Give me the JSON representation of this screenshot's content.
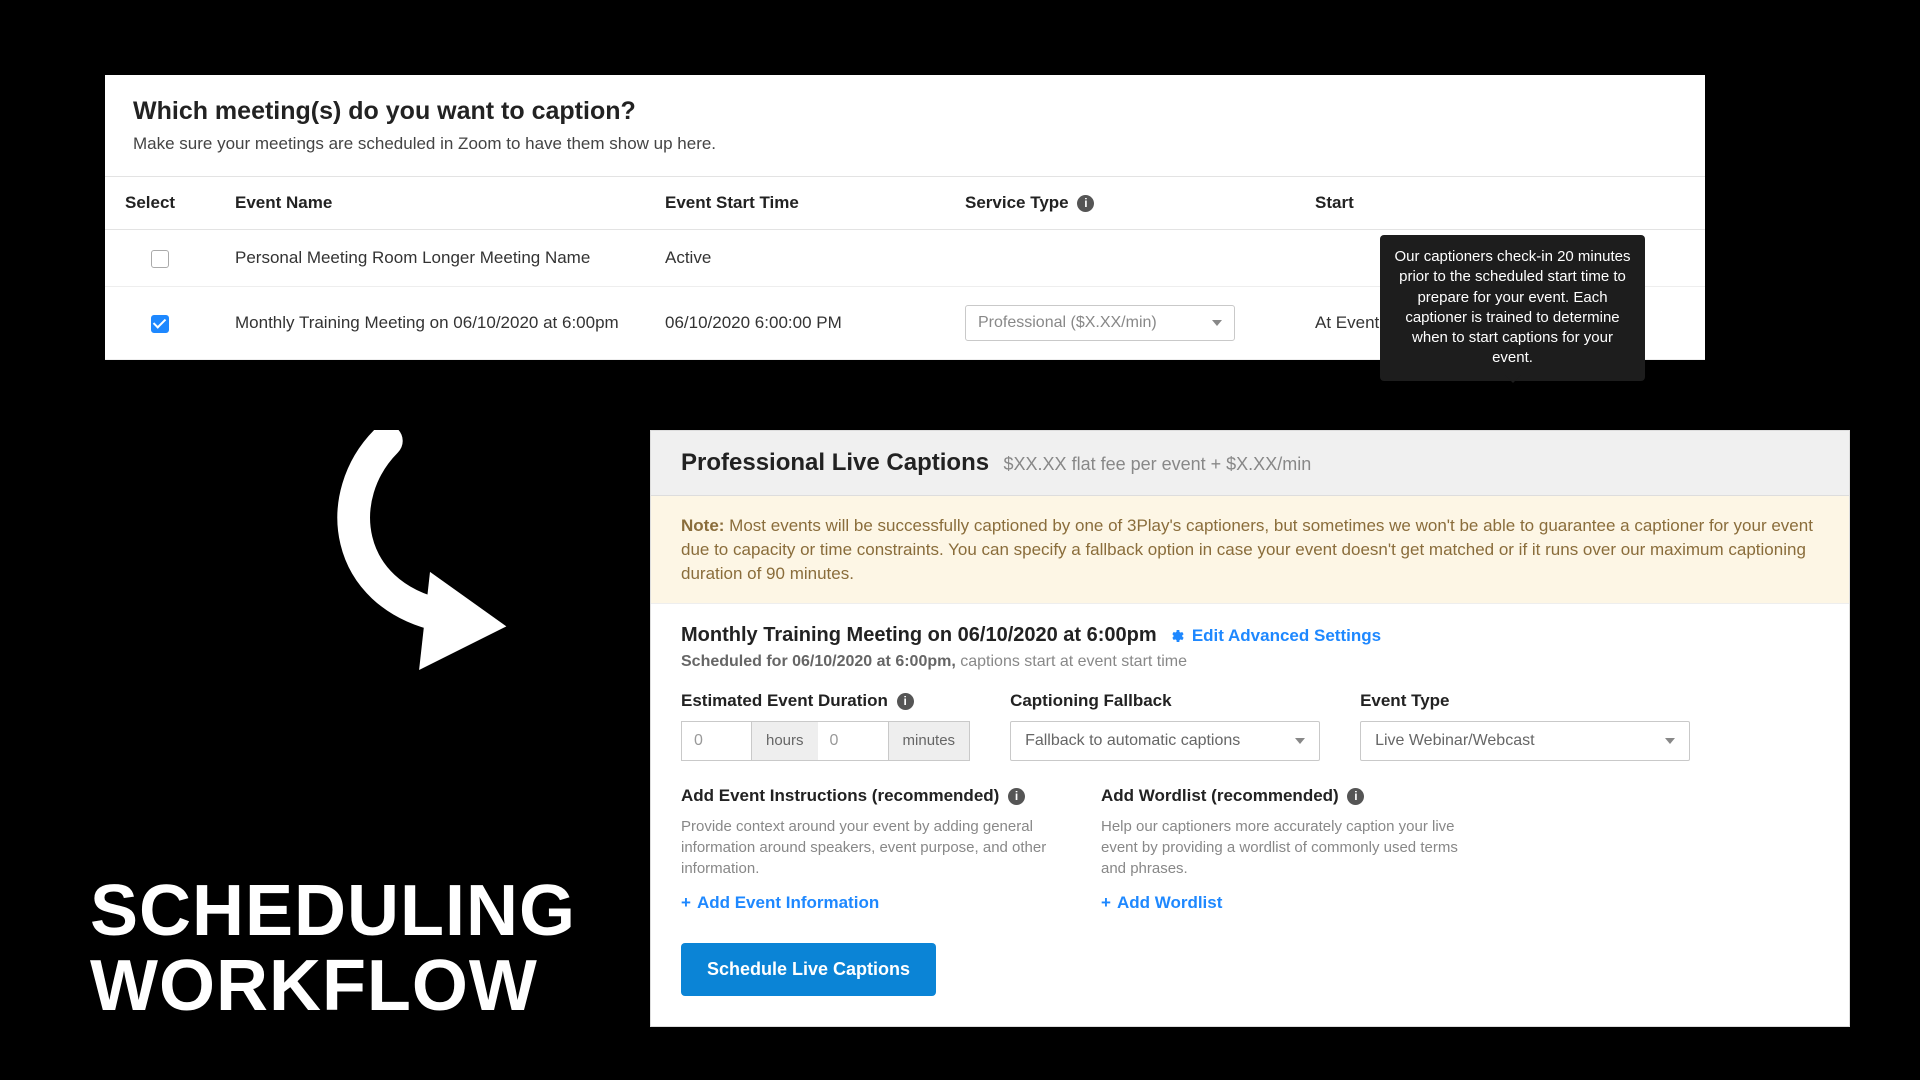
{
  "slide_caption_line1": "SCHEDULING",
  "slide_caption_line2": "WORKFLOW",
  "top": {
    "heading": "Which meeting(s) do you want to caption?",
    "subheading": "Make sure your meetings are scheduled in Zoom to have them show up here.",
    "columns": {
      "select": "Select",
      "event_name": "Event Name",
      "event_start_time": "Event Start Time",
      "service_type": "Service Type",
      "start_captions": "Start"
    },
    "rows": [
      {
        "checked": false,
        "event_name": "Personal Meeting Room Longer Meeting Name",
        "event_start_time": "Active",
        "service_type": "",
        "start_captions": ""
      },
      {
        "checked": true,
        "event_name": "Monthly Training Meeting on 06/10/2020 at 6:00pm",
        "event_start_time": "06/10/2020 6:00:00 PM",
        "service_type": "Professional ($X.XX/min)",
        "start_captions": "At Event Start Time"
      }
    ],
    "tooltip": "Our captioners check-in 20 minutes prior to the scheduled start time to prepare for your event. Each captioner is trained to determine when to start captions for your event."
  },
  "bottom": {
    "title": "Professional Live Captions",
    "price": "$XX.XX flat fee per event + $X.XX/min",
    "note_label": "Note:",
    "note_body": " Most events will be successfully captioned by one of 3Play's captioners, but sometimes we won't be able to guarantee a captioner for your event due to capacity or time constraints. You can specify a fallback option in case your event doesn't get matched or if it runs over our maximum captioning duration of 90 minutes.",
    "event_title": "Monthly Training Meeting on 06/10/2020 at 6:00pm",
    "edit_link": "Edit Advanced Settings",
    "event_sub_strong": "Scheduled for 06/10/2020 at 6:00pm,",
    "event_sub_rest": " captions start at event start time",
    "duration": {
      "label": "Estimated Event Duration",
      "hours_value": "0",
      "hours_unit": "hours",
      "minutes_value": "0",
      "minutes_unit": "minutes"
    },
    "fallback": {
      "label": "Captioning Fallback",
      "value": "Fallback to automatic captions"
    },
    "event_type": {
      "label": "Event Type",
      "value": "Live Webinar/Webcast"
    },
    "instructions": {
      "label": "Add Event Instructions (recommended)",
      "help": "Provide context around your event by adding general information around speakers, event purpose, and other information.",
      "link": "Add Event Information"
    },
    "wordlist": {
      "label": "Add Wordlist (recommended)",
      "help": "Help our captioners more accurately caption your live event by providing a wordlist of commonly used terms and phrases.",
      "link": "Add Wordlist"
    },
    "cta": "Schedule Live Captions"
  }
}
